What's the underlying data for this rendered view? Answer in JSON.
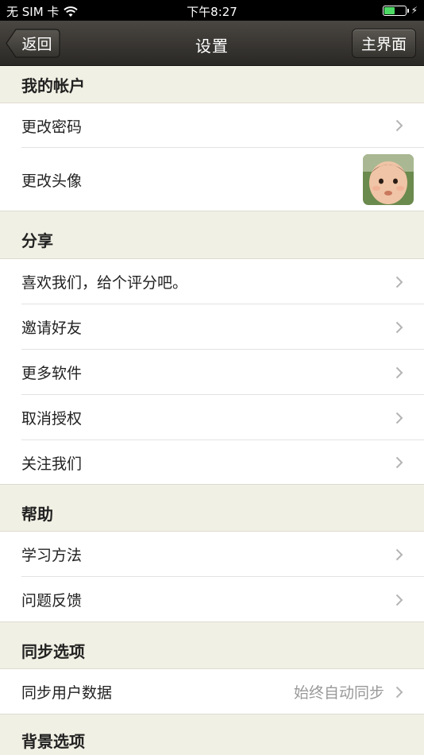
{
  "status_bar": {
    "carrier": "无 SIM 卡",
    "time": "下午8:27",
    "battery_level": 0.5,
    "icons": [
      "wifi-icon",
      "battery-icon",
      "charging-bolt-icon"
    ]
  },
  "nav": {
    "back_label": "返回",
    "title": "设置",
    "home_label": "主界面"
  },
  "sections": {
    "account": {
      "header": "我的帐户",
      "change_password": "更改密码",
      "change_avatar": "更改头像"
    },
    "share": {
      "header": "分享",
      "rate_us": "喜欢我们，给个评分吧。",
      "invite_friends": "邀请好友",
      "more_apps": "更多软件",
      "revoke_auth": "取消授权",
      "follow_us": "关注我们"
    },
    "help": {
      "header": "帮助",
      "learning_method": "学习方法",
      "feedback": "问题反馈"
    },
    "sync": {
      "header": "同步选项",
      "sync_user_data": "同步用户数据",
      "sync_user_data_value": "始终自动同步"
    },
    "background": {
      "header": "背景选项"
    }
  },
  "colors": {
    "nav_bar": "#3a3834",
    "section_bg": "#f1f0e4",
    "row_bg": "#ffffff",
    "battery": "#4cd964"
  }
}
